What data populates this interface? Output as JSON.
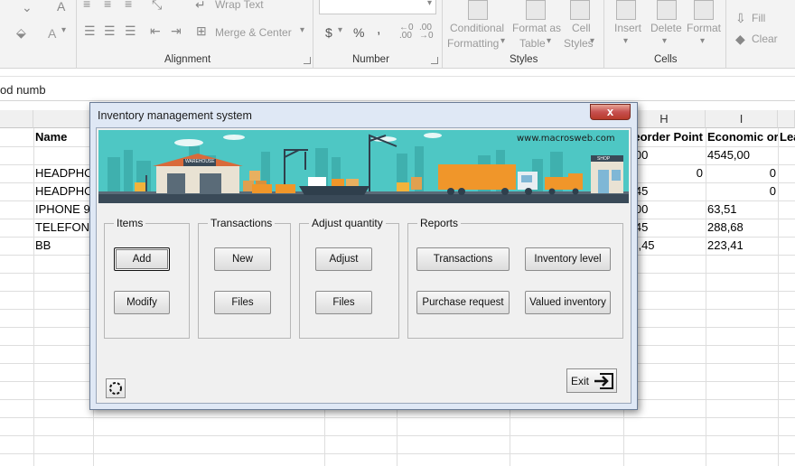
{
  "ribbon": {
    "wrap_text": "Wrap Text",
    "merge_center": "Merge & Center",
    "alignment_label": "Alignment",
    "number_label": "Number",
    "styles_label": "Styles",
    "cells_label": "Cells",
    "conditional": "Conditional",
    "formatting": "Formatting",
    "format_as": "Format as",
    "table": "Table",
    "cell": "Cell",
    "styles_btn": "Styles",
    "insert": "Insert",
    "delete": "Delete",
    "format": "Format",
    "fill": "Fill",
    "clear": "Clear",
    "currency": "$",
    "percent": "%",
    "comma": ",",
    "letter_a": "A"
  },
  "formula_bar": {
    "value": "od numb"
  },
  "sheet": {
    "col_h": "H",
    "col_i": "I",
    "cells": {
      "a_name": "Name",
      "a1": "HEADPHO",
      "a2": "HEADPHO",
      "a3": "IPHONE 9",
      "a4": "TELEFONO",
      "a5": "BB",
      "h_head": "Reorder Point",
      "i_head": "Economic or",
      "j_head": "Lea",
      "h0": "3,00",
      "h1": "0",
      "h2": "2,45",
      "h3": "3,00",
      "h4": "2,45",
      "h5": "23,45",
      "i0": "4545,00",
      "i1": "0",
      "i2": "0",
      "i3": "63,51",
      "i4": "288,68",
      "i5": "223,41"
    }
  },
  "dialog": {
    "title": "Inventory management system",
    "close": "x",
    "banner_url": "www.macrosweb.com",
    "banner_warehouse": "WAREHOUSE",
    "banner_shop": "SHOP",
    "items_title": "Items",
    "add": "Add",
    "modify": "Modify",
    "transactions_title": "Transactions",
    "new": "New",
    "files1": "Files",
    "adjust_title": "Adjust quantity",
    "adjust": "Adjust",
    "files2": "Files",
    "reports_title": "Reports",
    "rep_transactions": "Transactions",
    "inventory_level": "Inventory level",
    "purchase_request": "Purchase request",
    "valued_inventory": "Valued inventory",
    "exit": "Exit"
  },
  "colors": {
    "banner_teal": "#4ec7c4",
    "truck_orange": "#f0962a"
  }
}
